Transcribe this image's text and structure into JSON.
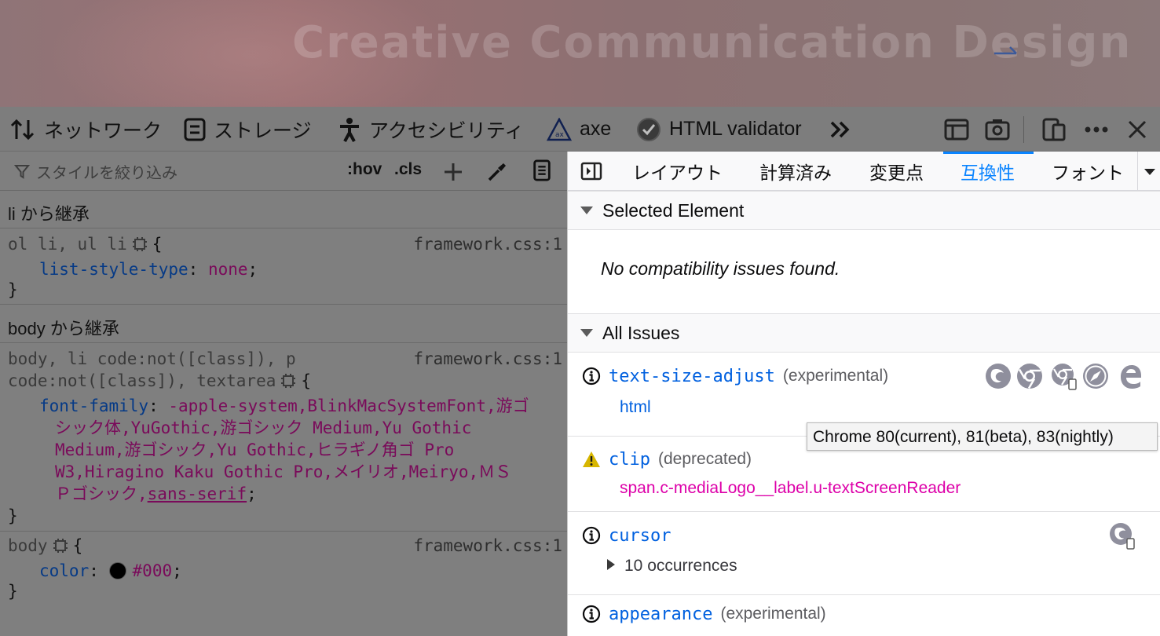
{
  "page": {
    "hero_title": "Creative Communication Design"
  },
  "toolbar": {
    "tabs": [
      {
        "label": "ネットワーク",
        "icon": "network-arrows-icon"
      },
      {
        "label": "ストレージ",
        "icon": "storage-icon"
      },
      {
        "label": "アクセシビリティ",
        "icon": "accessibility-icon"
      },
      {
        "label": "axe",
        "icon": "axe-icon"
      },
      {
        "label": "HTML validator",
        "icon": "html-validator-icon"
      }
    ],
    "overflow_icon": "chevron-double-right-icon",
    "right_icons": [
      "frame-icon",
      "screenshot-icon",
      "responsive-icon",
      "more-icon",
      "close-icon"
    ]
  },
  "rules": {
    "filter_placeholder": "スタイルを絞り込み",
    "hov": ":hov",
    "cls": ".cls",
    "inherit_li": "li から継承",
    "rule1": {
      "selector_a": "ol li, ul li",
      "source": "framework.css:1",
      "prop": "list-style-type",
      "value": "none"
    },
    "inherit_body": "body から継承",
    "rule2": {
      "selector_line1": "body, li code:not([class]), p",
      "selector_line2": "code:not([class]), textarea",
      "source": "framework.css:1",
      "prop": "font-family",
      "value_line1": "-apple-system,BlinkMacSystemFont,游ゴ",
      "value_line2": "シック体,YuGothic,游ゴシック Medium,Yu Gothic",
      "value_line3": "Medium,游ゴシック,Yu Gothic,ヒラギノ角ゴ Pro",
      "value_line4": "W3,Hiragino Kaku Gothic Pro,メイリオ,Meiryo,ＭＳ",
      "value_line5a": "Ｐゴシック,",
      "value_line5b": "sans-serif"
    },
    "rule3": {
      "selector": "body",
      "source": "framework.css:1",
      "prop": "color",
      "value": "#000",
      "swatch_color": "#000000"
    },
    "open_brace": "{",
    "close_brace": "}",
    "colon": ":",
    "semicolon": ";"
  },
  "sidebar": {
    "tabs": [
      "レイアウト",
      "計算済み",
      "変更点",
      "互換性",
      "フォント"
    ],
    "active_tab": "互換性",
    "selected_element_header": "Selected Element",
    "no_issues": "No compatibility issues found.",
    "all_issues_header": "All Issues",
    "issues": [
      {
        "prop": "text-size-adjust",
        "tag": "(experimental)",
        "node": "html",
        "severity": "info",
        "browsers": [
          "firefox-icon",
          "chrome-icon",
          "chrome-android-icon",
          "safari-icon",
          "edge-icon"
        ]
      },
      {
        "prop": "clip",
        "tag": "(deprecated)",
        "node": "span.c-mediaLogo__label.u-textScreenReader",
        "severity": "warning",
        "browsers": []
      },
      {
        "prop": "cursor",
        "tag": "",
        "occurrences": "10 occurrences",
        "severity": "info",
        "browsers": [
          "firefox-android-icon"
        ]
      },
      {
        "prop": "appearance",
        "tag": "(experimental)",
        "severity": "info",
        "browsers": []
      }
    ],
    "tooltip": "Chrome 80(current), 81(beta), 83(nightly)"
  }
}
